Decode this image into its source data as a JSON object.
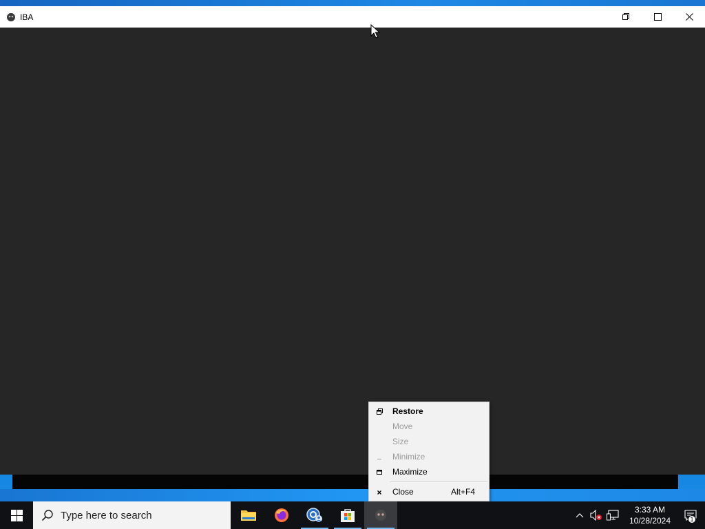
{
  "window": {
    "title": "IBA"
  },
  "system_menu": {
    "items": [
      {
        "label": "Restore",
        "enabled": true,
        "bold": true,
        "icon": "restore-glyph"
      },
      {
        "label": "Move",
        "enabled": false
      },
      {
        "label": "Size",
        "enabled": false
      },
      {
        "label": "Minimize",
        "enabled": false,
        "icon": "minimize-glyph"
      },
      {
        "label": "Maximize",
        "enabled": true,
        "icon": "maximize-glyph"
      },
      {
        "label": "Close",
        "enabled": true,
        "icon": "close-glyph",
        "shortcut": "Alt+F4"
      }
    ]
  },
  "taskbar": {
    "search_placeholder": "Type here to search",
    "apps": [
      "file-explorer-icon",
      "firefox-icon",
      "remote-desktop-icon",
      "microsoft-store-icon",
      "iba-app-icon"
    ],
    "clock_time": "3:33 AM",
    "clock_date": "10/28/2024",
    "notification_count": "1"
  },
  "colors": {
    "window_bg": "#262626",
    "taskbar_bg": "#101114",
    "menu_bg": "#f2f2f2",
    "accent": "#76b9ed"
  }
}
